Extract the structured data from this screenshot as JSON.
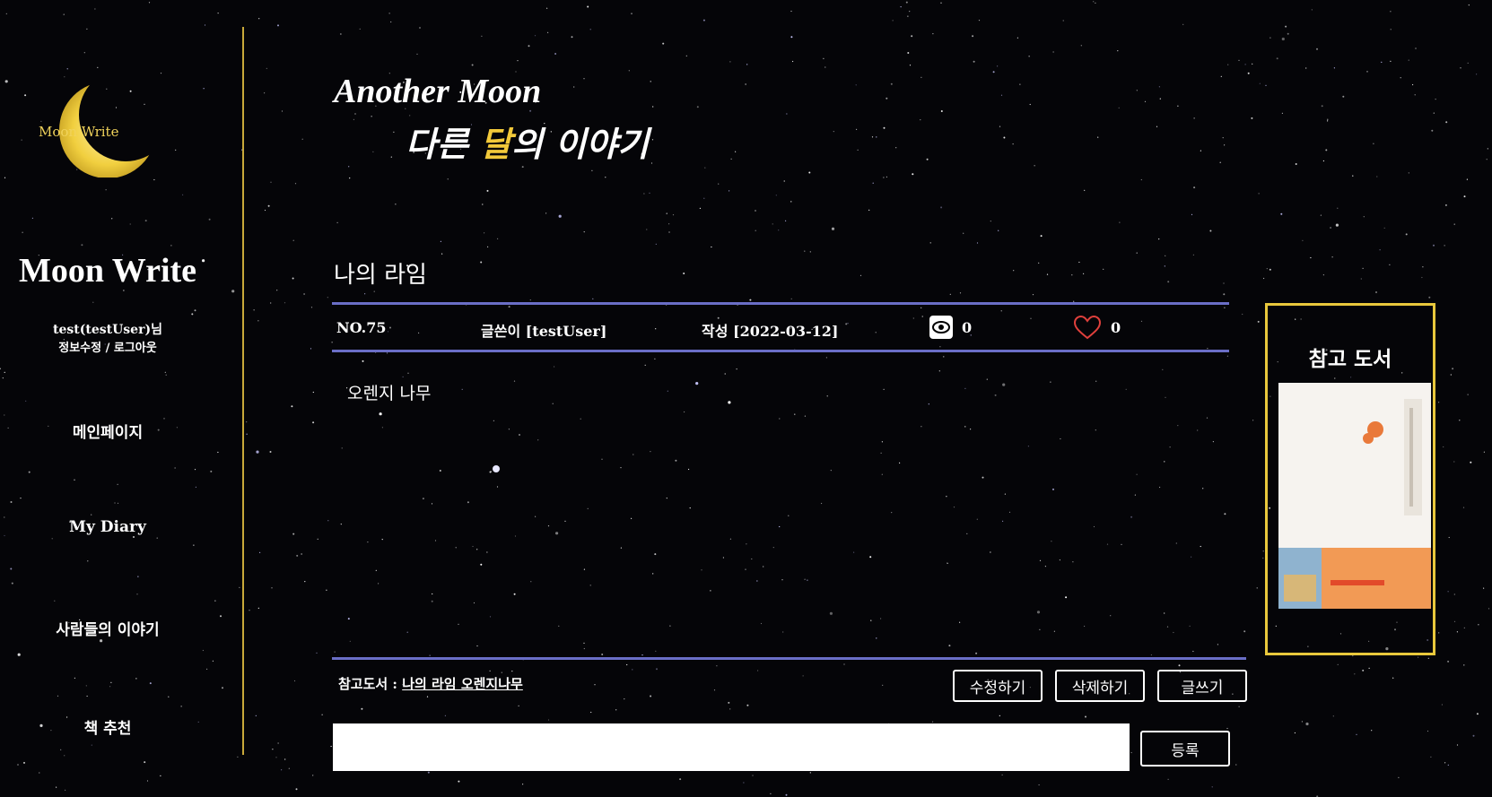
{
  "theme": {
    "accent": "#f2c93a",
    "rule": "#6a6ec6",
    "panel_border": "#e9c83c",
    "background": "#050508"
  },
  "sidebar": {
    "logo_text": "Moon Write",
    "brand": "Moon Write",
    "user_line": "test(testUser)님",
    "account_links": "정보수정 / 로그아웃",
    "nav": [
      "메인페이지",
      "My Diary",
      "사람들의 이야기",
      "책 추천"
    ]
  },
  "header": {
    "title_en": "Another Moon",
    "title_ko_pre": "다른 ",
    "title_ko_accent": "달",
    "title_ko_post": "의 이야기"
  },
  "post": {
    "title": "나의 라임",
    "number": "NO.75",
    "author": "글쓴이 [testUser]",
    "date": "작성 [2022-03-12]",
    "views": "0",
    "likes": "0",
    "body": "오렌지 나무",
    "view_icon": "eye-icon",
    "like_icon": "heart-icon"
  },
  "ref_panel": {
    "title": "참고 도서",
    "cover_icon": "book-cover-image"
  },
  "footer": {
    "ref_label": "참고도서 : ",
    "ref_value": "나의 라임 오렌지나무",
    "edit_label": "수정하기",
    "delete_label": "삭제하기",
    "write_label": "글쓰기",
    "submit_label": "등록",
    "comment_value": ""
  }
}
